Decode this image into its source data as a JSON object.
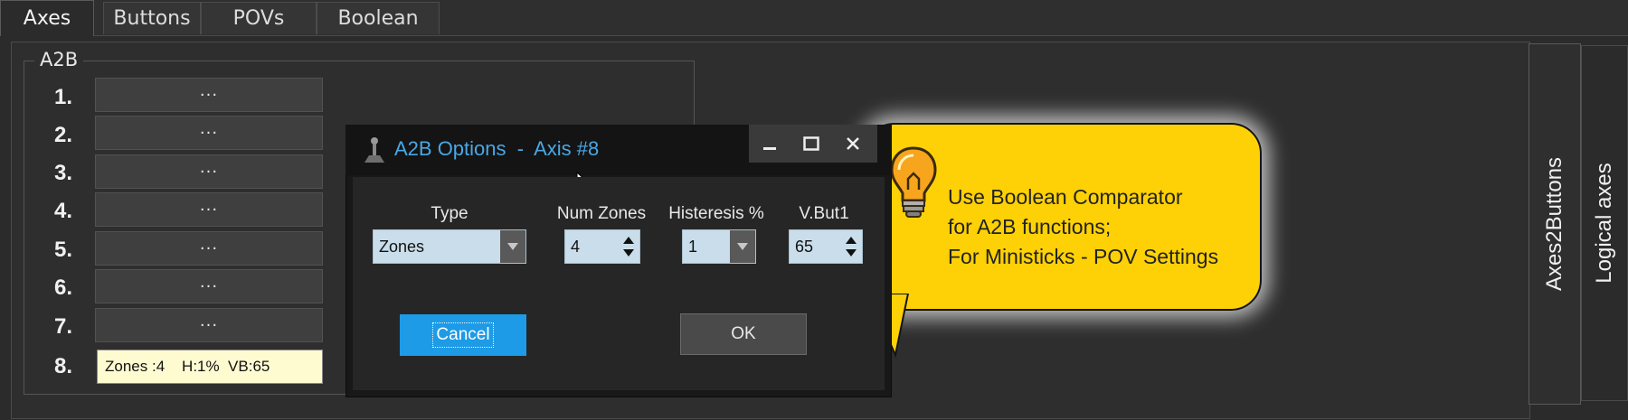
{
  "tabs": [
    {
      "label": "Axes",
      "active": true
    },
    {
      "label": "Buttons",
      "active": false
    },
    {
      "label": "POVs",
      "active": false
    },
    {
      "label": "Boolean",
      "active": false
    }
  ],
  "group": {
    "title": "A2B",
    "rows": [
      {
        "num": "1.",
        "button": "···"
      },
      {
        "num": "2.",
        "button": "···"
      },
      {
        "num": "3.",
        "button": "···"
      },
      {
        "num": "4.",
        "button": "···"
      },
      {
        "num": "5.",
        "button": "···"
      },
      {
        "num": "6.",
        "button": "···"
      },
      {
        "num": "7.",
        "button": "···"
      },
      {
        "num": "8.",
        "status": "Zones :4    H:1%  VB:65"
      }
    ]
  },
  "side_tabs": [
    "Axes2Buttons",
    "Logical axes"
  ],
  "tooltip": {
    "lines": [
      "Use Boolean Comparator",
      "for A2B functions;",
      "For Ministicks - POV Settings"
    ],
    "icon": "lightbulb-icon"
  },
  "dialog": {
    "title": "A2B Options  -  Axis #8",
    "icon": "joystick-icon",
    "fields": {
      "type": {
        "label": "Type",
        "value": "Zones"
      },
      "num_zones": {
        "label": "Num Zones",
        "value": "4"
      },
      "histeresis": {
        "label": "Histeresis %",
        "value": "1"
      },
      "vbut1": {
        "label": "V.But1",
        "value": "65"
      }
    },
    "cancel_label": "Cancel",
    "ok_label": "OK"
  },
  "colors": {
    "accent": "#1e9be6",
    "title_text": "#49a8e6",
    "tooltip_bg": "#fdd106",
    "status_bg": "#fffbd1"
  }
}
